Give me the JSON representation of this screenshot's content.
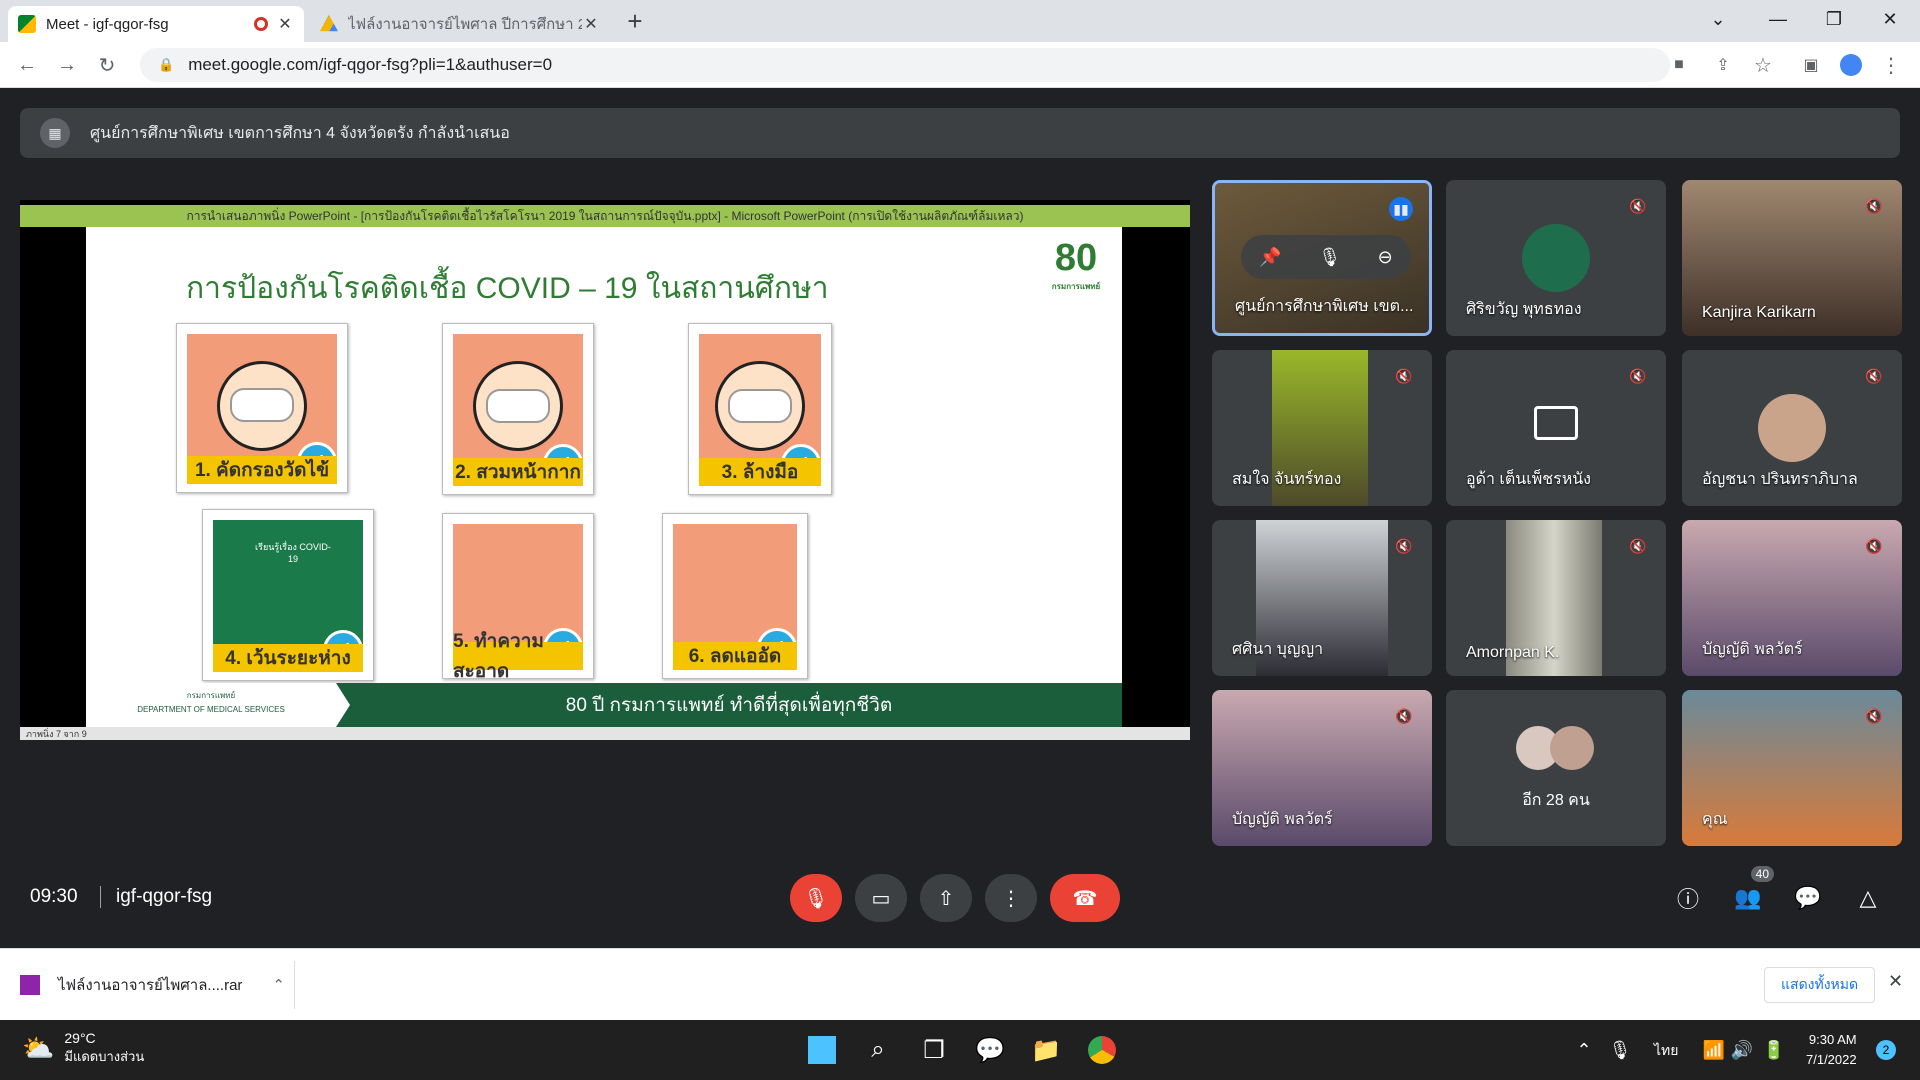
{
  "browser": {
    "tabs": [
      {
        "title": "Meet - igf-qgor-fsg",
        "active": true
      },
      {
        "title": "ไฟล์งานอาจารย์ไพศาล ปีการศึกษา 25",
        "active": false
      }
    ],
    "url": "meet.google.com/igf-qgor-fsg?pli=1&authuser=0"
  },
  "meet": {
    "banner_text": "ศูนย์การศึกษาพิเศษ เขตการศึกษา 4 จังหวัดตรัง กำลังนำเสนอ",
    "time": "09:30",
    "meeting_code": "igf-qgor-fsg",
    "participant_count": "40",
    "tiles": [
      {
        "name": "ศูนย์การศึกษาพิเศษ เขต...",
        "speaking": true
      },
      {
        "name": "ศิริขวัญ พุทธทอง"
      },
      {
        "name": "Kanjira Karikarn"
      },
      {
        "name": "สมใจ จันทร์ทอง"
      },
      {
        "name": "อูด้า เต็นเพ็ชรหนัง"
      },
      {
        "name": "อัญชนา ปรินทราภิบาล"
      },
      {
        "name": "ศศินา บุญญา"
      },
      {
        "name": "Amornpan K."
      },
      {
        "name": "บัญญัติ พลวัตร์"
      },
      {
        "name": "บัญญัติ พลวัตร์"
      },
      {
        "name": "อีก 28 คน"
      },
      {
        "name": "คุณ"
      }
    ]
  },
  "presentation": {
    "window_title": "การนำเสนอภาพนิ่ง PowerPoint - [การป้องกันโรคติดเชื้อไวรัสโคโรนา 2019 ในสถานการณ์ปัจจุบัน.pptx] - Microsoft PowerPoint (การเปิดใช้งานผลิตภัณฑ์ล้มเหลว)",
    "slide_title": "การป้องกันโรคติดเชื้อ COVID – 19 ในสถานศึกษา",
    "cards": [
      "1. คัดกรองวัดไข้",
      "2. สวมหน้ากาก",
      "3. ล้างมือ",
      "4. เว้นระยะห่าง",
      "5. ทำความสะอาด",
      "6. ลดแออัด"
    ],
    "footer_text": "80 ปี กรมการแพทย์ ทำดีที่สุดเพื่อทุกชีวิต",
    "dept_th": "กรมการแพทย์",
    "dept_en": "DEPARTMENT OF MEDICAL SERVICES",
    "logo_text": "80",
    "status": "ภาพนิ่ง 7 จาก 9",
    "classroom_sign": "เรียนรู้เรื่อง COVID-19"
  },
  "download": {
    "file": "ไฟล์งานอาจารย์ไพศาล....rar",
    "show_all": "แสดงทั้งหมด"
  },
  "taskbar": {
    "temp": "29°C",
    "weather": "มีแดดบางส่วน",
    "lang": "ไทย",
    "time": "9:30 AM",
    "date": "7/1/2022",
    "notif": "2"
  }
}
